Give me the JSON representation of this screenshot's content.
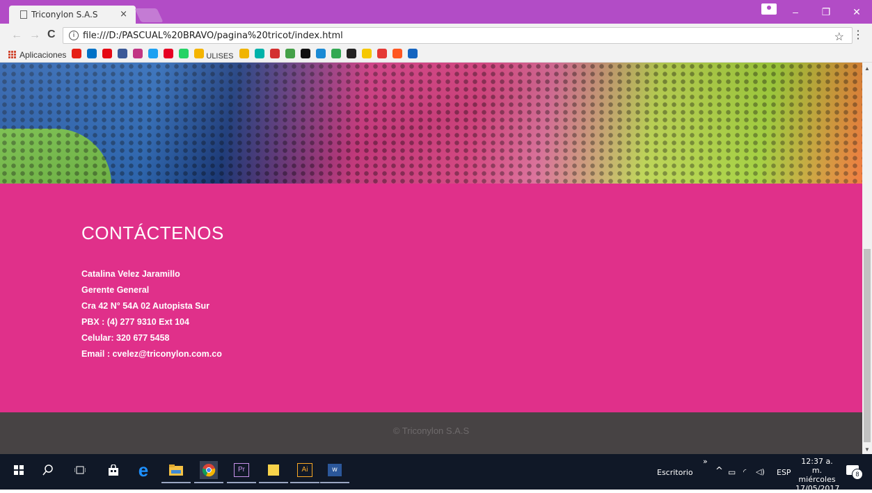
{
  "browser": {
    "tab_title": "Triconylon S.A.S",
    "tab_close": "×",
    "url": "file:///D:/PASCUAL%20BRAVO/pagina%20tricot/index.html",
    "back": "←",
    "forward": "→",
    "reload": "C",
    "star": "☆",
    "menu": "⋮",
    "win_minimize": "–",
    "win_restore": "❐",
    "win_close": "✕"
  },
  "bookmarks": {
    "apps_label": "Aplicaciones",
    "ulises_label": "ULISES",
    "colors": [
      "#e62117",
      "#0072c6",
      "#e50914",
      "#3b5998",
      "#c13584",
      "#1da1f2",
      "#e60023",
      "#25d366",
      "#f4b400",
      "#f0b400",
      "#00b2a9",
      "#d32f2f",
      "#43a047",
      "#111111",
      "#1a8ad4",
      "#34a853",
      "#222222",
      "#f6c700",
      "#e53935",
      "#ff5722",
      "#1565c0"
    ]
  },
  "contact": {
    "heading": "CONTÁCTENOS",
    "name": "Catalina Velez Jaramillo",
    "role": "Gerente General",
    "address": "Cra 42 N° 54A 02 Autopista Sur",
    "pbx": "PBX : (4) 277 9310 Ext 104",
    "cell": "Celular: 320 677 5458",
    "email": "Email : cvelez@triconylon.com.co"
  },
  "footer": {
    "copyright": "© Triconylon S.A.S"
  },
  "taskbar": {
    "desktop_label": "Escritorio",
    "lang": "ESP",
    "time": "12:37 a. m.",
    "day": "miércoles",
    "date": "17/05/2017",
    "notifications": "8",
    "more": "»"
  },
  "colors": {
    "title_bar": "#b24cc6",
    "contact_bg": "#e0308a",
    "footer_bg": "#474344",
    "taskbar_bg": "#101827"
  }
}
